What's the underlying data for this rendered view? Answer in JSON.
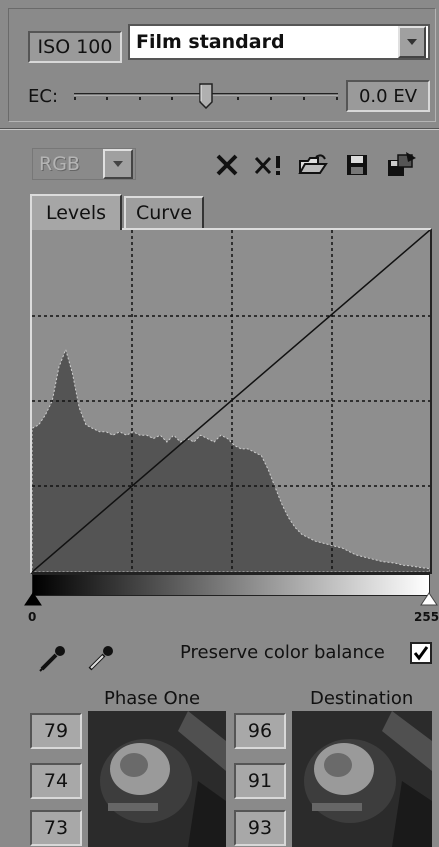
{
  "iso": {
    "label": "ISO 100"
  },
  "preset": {
    "value": "Film standard"
  },
  "ec": {
    "label": "EC:",
    "value": "0.0 EV",
    "fraction": 0.5
  },
  "channel": {
    "value": "RGB"
  },
  "toolbar": {
    "icons": [
      "delete-icon",
      "reset-all-icon",
      "open-folder-icon",
      "save-icon",
      "copy-settings-icon"
    ]
  },
  "tabs": [
    {
      "label": "Levels"
    },
    {
      "label": "Curve"
    }
  ],
  "levels": {
    "input_min": "0",
    "input_max": "255",
    "histogram": [
      0.42,
      0.43,
      0.46,
      0.5,
      0.6,
      0.65,
      0.58,
      0.48,
      0.43,
      0.42,
      0.41,
      0.41,
      0.4,
      0.41,
      0.4,
      0.41,
      0.4,
      0.4,
      0.39,
      0.4,
      0.38,
      0.4,
      0.38,
      0.39,
      0.38,
      0.4,
      0.39,
      0.38,
      0.4,
      0.39,
      0.37,
      0.36,
      0.36,
      0.35,
      0.34,
      0.3,
      0.25,
      0.2,
      0.16,
      0.13,
      0.11,
      0.1,
      0.09,
      0.085,
      0.08,
      0.075,
      0.07,
      0.06,
      0.05,
      0.045,
      0.04,
      0.035,
      0.03,
      0.028,
      0.025,
      0.02,
      0.018,
      0.015,
      0.012,
      0.01
    ]
  },
  "preserve": {
    "label": "Preserve color balance",
    "checked": true
  },
  "samples": {
    "left_title": "Phase One",
    "right_title": "Destination",
    "left_values": [
      "79",
      "74",
      "73"
    ],
    "right_values": [
      "96",
      "91",
      "93"
    ]
  },
  "colors": {
    "panel": "#8a8a8a",
    "histogram": "#545454",
    "grid": "#111111"
  }
}
